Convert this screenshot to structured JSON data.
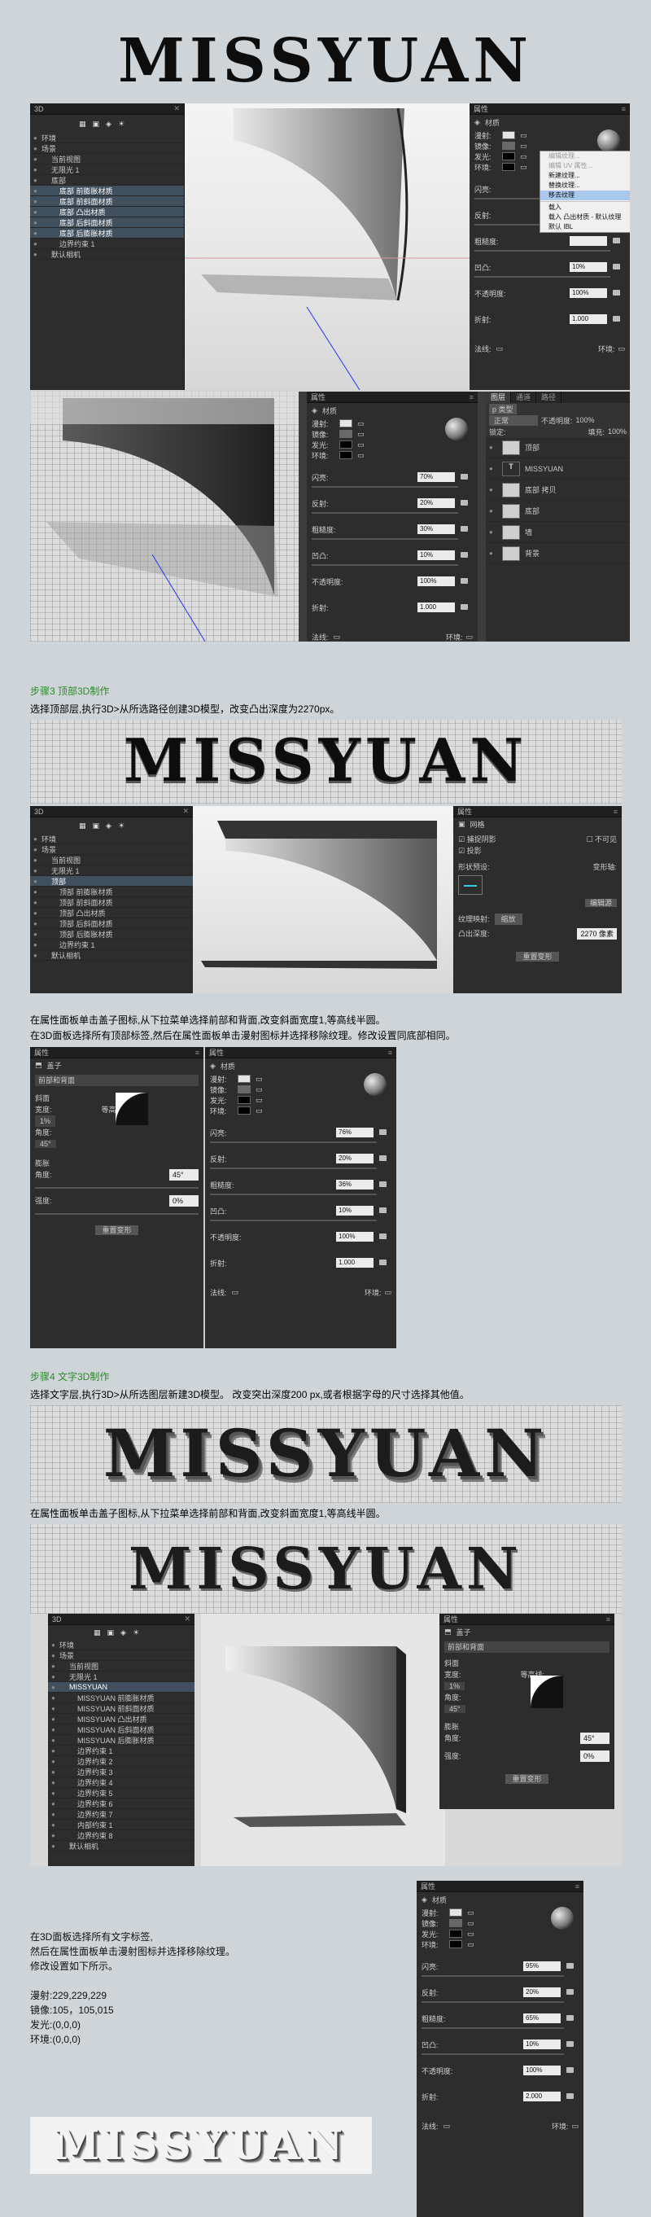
{
  "logo": "MISSYUAN",
  "layers3d": {
    "a": [
      "环境",
      "场景",
      "当前视图",
      "无限光 1",
      "底部",
      "底部 前膨胀材质",
      "底部 前斜面材质",
      "底部 凸出材质",
      "底部 后斜面材质",
      "底部 后膨胀材质",
      "边界约束 1",
      "默认相机"
    ],
    "b": [
      "环境",
      "场景",
      "当前视图",
      "无限光 1",
      "顶部",
      "顶部 前膨胀材质",
      "顶部 前斜面材质",
      "顶部 凸出材质",
      "顶部 后斜面材质",
      "顶部 后膨胀材质",
      "边界约束 1",
      "默认相机"
    ],
    "c": [
      "环境",
      "场景",
      "当前视图",
      "无限光 1",
      "MISSYUAN",
      "MISSYUAN 前膨胀材质",
      "MISSYUAN 前斜面材质",
      "MISSYUAN 凸出材质",
      "MISSYUAN 后斜面材质",
      "MISSYUAN 后膨胀材质",
      "边界约束 1",
      "边界约束 2",
      "边界约束 3",
      "边界约束 4",
      "边界约束 5",
      "边界约束 6",
      "边界约束 7",
      "内部约束 1",
      "边界约束 8",
      "默认相机"
    ]
  },
  "material": {
    "header": "属性",
    "tab": "材质",
    "diffuse": "漫射:",
    "specular": "镜像:",
    "illum": "发光:",
    "ambient": "环境:",
    "shine": "闪亮:",
    "reflect": "反射:",
    "rough": "粗糙度:",
    "bump": "凹凸:",
    "opacity": "不透明度:",
    "refract": "折射:",
    "normal": "法线:",
    "envir": "环境:",
    "v1": {
      "shine": "70%",
      "reflect": "20%",
      "rough": "",
      "bump": "10%",
      "opacity": "100%",
      "refract": "1.000"
    },
    "v2": {
      "shine": "70%",
      "reflect": "20%",
      "rough": "30%",
      "bump": "10%",
      "opacity": "100%",
      "refract": "1.000"
    },
    "v3": {
      "shine": "76%",
      "reflect": "20%",
      "rough": "36%",
      "bump": "10%",
      "opacity": "100%",
      "refract": "1.000"
    },
    "v4": {
      "shine": "95%",
      "reflect": "20%",
      "rough": "65%",
      "bump": "10%",
      "opacity": "100%",
      "refract": "2.000"
    }
  },
  "context_menu": [
    "编辑纹理...",
    "编辑 UV 属性...",
    "新建纹理...",
    "替换纹理...",
    "移去纹理",
    "",
    "载入",
    "载入 凸出材质 - 默认纹理",
    "默认 IBL"
  ],
  "layers_panel": {
    "tabs": [
      "图层",
      "通道",
      "路径"
    ],
    "kind": "p 类型",
    "mode": "正常",
    "opacity_label": "不透明度:",
    "opacity": "100%",
    "lock": "锁定:",
    "fill_label": "填充:",
    "fill": "100%",
    "items": [
      "顶部",
      "MISSYUAN",
      "底部 拷贝",
      "底部",
      "墙",
      "背景"
    ]
  },
  "step3": {
    "title": "步骤3 顶部3D制作",
    "desc": "选择顶部层,执行3D>从所选路径创建3D模型，改变凸出深度为2270px。",
    "note1": "在属性面板单击盖子图标,从下拉菜单选择前部和背面,改变斜面宽度1,等高线半圆。",
    "note2": "在3D面板选择所有顶部标签,然后在属性面板单击漫射图标并选择移除纹理。修改设置同底部相同。"
  },
  "mesh_panel": {
    "tab": "网格",
    "catch": "捕捉阴影",
    "cast": "投影",
    "invisible": "不可见",
    "shape": "形状预设:",
    "deform_axis": "变形轴:",
    "edit_source": "编辑源",
    "texture": "纹理映射:",
    "texture_val": "缩放",
    "extrude": "凸出深度:",
    "extrude_val": "2270 像素"
  },
  "cap_panel": {
    "tab": "盖子",
    "sides": "前部和背面",
    "bevel": "斜面",
    "width": "宽度:",
    "width_val": "1%",
    "contour": "等高线:",
    "angle": "角度:",
    "angle_val": "45°",
    "inflate": "膨胀",
    "angle2": "角度:",
    "angle2_val": "45°",
    "strength": "强度:",
    "strength_val": "0%",
    "reset": "重置变形"
  },
  "step4": {
    "title": "步骤4 文字3D制作",
    "desc": "选择文字层,执行3D>从所选图层新建3D模型。 改变突出深度200 px,或者根据字母的尺寸选择其他值。",
    "note1": "在属性面板单击盖子图标,从下拉菜单选择前部和背面,改变斜面宽度1,等高线半圆。"
  },
  "final_notes": [
    "在3D面板选择所有文字标签,",
    "然后在属性面板单击漫射图标并选择移除纹理。",
    "修改设置如下所示。",
    "",
    "漫射:229,229,229",
    "镜像:105，105,015",
    "发光:(0,0,0)",
    "环境:(0,0,0)"
  ],
  "panel_3d": "3D",
  "layer_label": "属性"
}
